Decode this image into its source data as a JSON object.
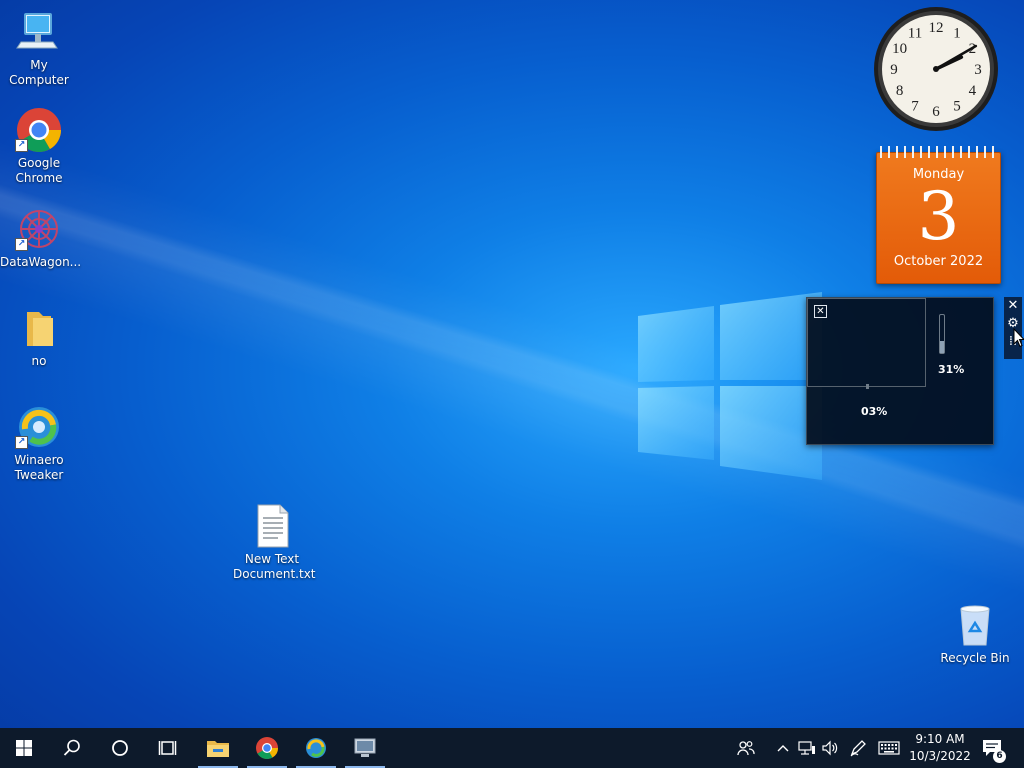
{
  "desktop": {
    "icons": [
      {
        "label": "My Computer",
        "icon": "computer-icon"
      },
      {
        "label": "Google Chrome",
        "icon": "chrome-icon",
        "shortcut": true
      },
      {
        "label": "DataWagon...",
        "icon": "datawagon-icon",
        "shortcut": true
      },
      {
        "label": "no",
        "icon": "folder-icon"
      },
      {
        "label": "Winaero Tweaker",
        "icon": "winaero-icon",
        "shortcut": true
      },
      {
        "label": "New Text Document.txt",
        "icon": "text-file-icon"
      },
      {
        "label": "Recycle Bin",
        "icon": "recycle-bin-icon"
      }
    ]
  },
  "gadgets": {
    "clock": {
      "hour": 2,
      "minute": 10,
      "numerals": [
        "12",
        "1",
        "2",
        "3",
        "4",
        "5",
        "6",
        "7",
        "8",
        "9",
        "10",
        "11"
      ]
    },
    "calendar": {
      "weekday": "Monday",
      "day": "3",
      "month_year": "October 2022"
    },
    "meter": {
      "close_glyph": "✕",
      "value_1": "03%",
      "value_2": "31%",
      "bar_level": 0.31
    },
    "toolbar": {
      "close_glyph": "✕",
      "options_glyph": "⚙",
      "drag_glyph": "⁞⁞"
    }
  },
  "taskbar": {
    "buttons": [
      "start-icon",
      "search-icon",
      "cortana-icon",
      "task-view-icon",
      "file-explorer-icon",
      "chrome-icon",
      "winaero-icon",
      "app-icon"
    ],
    "clock": {
      "time": "9:10 AM",
      "date": "10/3/2022"
    },
    "notifications_count": "6"
  },
  "colors": {
    "accent": "#0a6de6",
    "calendar": "#ec6a12",
    "taskbar": "#0d1a2b"
  }
}
